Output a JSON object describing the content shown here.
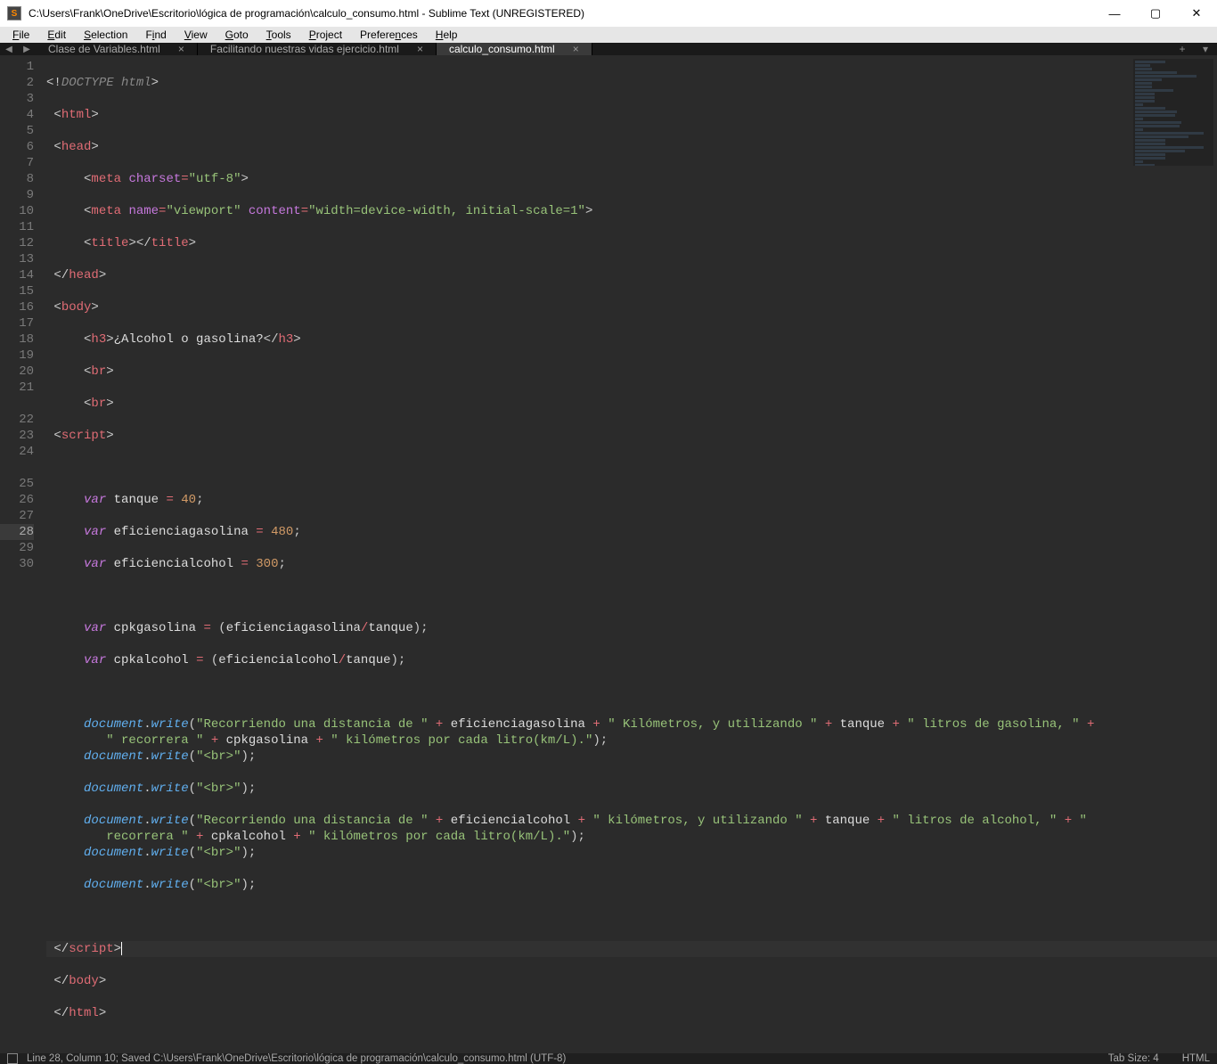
{
  "title": "C:\\Users\\Frank\\OneDrive\\Escritorio\\lógica de programación\\calculo_consumo.html - Sublime Text (UNREGISTERED)",
  "menu": [
    "File",
    "Edit",
    "Selection",
    "Find",
    "View",
    "Goto",
    "Tools",
    "Project",
    "Preferences",
    "Help"
  ],
  "tabs": [
    {
      "label": "Clase de Variables.html",
      "active": false
    },
    {
      "label": "Facilitando nuestras vidas ejercicio.html",
      "active": false
    },
    {
      "label": "calculo_consumo.html",
      "active": true
    }
  ],
  "gutter": {
    "start": 1,
    "end": 30,
    "highlight": 28
  },
  "code": {
    "doctype": "DOCTYPE html",
    "html_open": "html",
    "html_close": "html",
    "head_open": "head",
    "head_close": "head",
    "meta_charset_attr": "charset",
    "meta_charset_val": "\"utf-8\"",
    "meta_name_attr": "name",
    "meta_name_val": "\"viewport\"",
    "meta_content_attr": "content",
    "meta_content_val": "\"width=device-width, initial-scale=1\"",
    "title_tag": "title",
    "body_open": "body",
    "body_close": "body",
    "h3_tag": "h3",
    "h3_text": "¿Alcohol o gasolina?",
    "br_tag": "br",
    "script_tag": "script",
    "var_kw": "var",
    "tanque": "tanque",
    "tanque_val": "40",
    "efgas": "eficienciagasolina",
    "efgas_val": "480",
    "efalc": "eficiencialcohol",
    "efalc_val": "300",
    "cpkgas": "cpkgasolina",
    "cpkalc": "cpkalcohol",
    "document": "document",
    "write": "write",
    "str1": "\"Recorriendo una distancia de \"",
    "str2": "\" Kilómetros, y utilizando \"",
    "str3": "\" litros de gasolina, \"",
    "str4": "\" recorrera \"",
    "str5": "\" kilómetros por cada litro(km/L).\"",
    "str6": "\"<br>\"",
    "str7": "\" kilómetros, y utilizando \"",
    "str8": "\" litros de alcohol, \"",
    "str9": "\" recorrera \""
  },
  "status": {
    "left": "Line 28, Column 10; Saved C:\\Users\\Frank\\OneDrive\\Escritorio\\lógica de programación\\calculo_consumo.html (UTF-8)",
    "tabsize": "Tab Size: 4",
    "syntax": "HTML"
  }
}
